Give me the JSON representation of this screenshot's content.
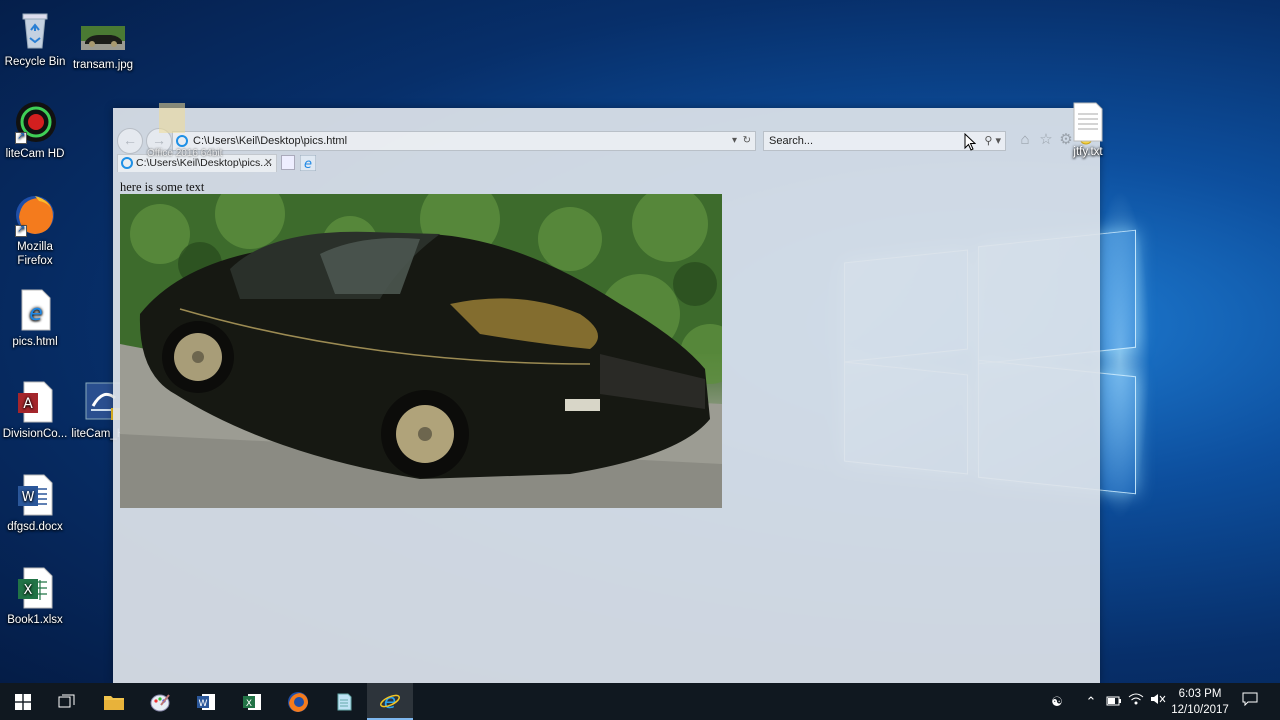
{
  "desktop": {
    "icons": [
      {
        "label": "Recycle Bin"
      },
      {
        "label": "transam.jpg"
      },
      {
        "label": "liteCam HD"
      },
      {
        "label": "Mozilla Firefox"
      },
      {
        "label": "pics.html"
      },
      {
        "label": "DivisionCo..."
      },
      {
        "label": "liteCam_H..."
      },
      {
        "label": "dfgsd.docx"
      },
      {
        "label": "Book1.xlsx"
      },
      {
        "label": "jtfy.txt"
      }
    ],
    "ghost_label": "Office 2016 64bit"
  },
  "browser": {
    "address": "C:\\Users\\Keil\\Desktop\\pics.html",
    "search_placeholder": "Search...",
    "tab_title": "C:\\Users\\Keil\\Desktop\\pics....",
    "page": {
      "text": "here is some text",
      "image_alt": "Black Pontiac Trans Am"
    }
  },
  "taskbar": {
    "clock_time": "6:03 PM",
    "clock_date": "12/10/2017"
  }
}
